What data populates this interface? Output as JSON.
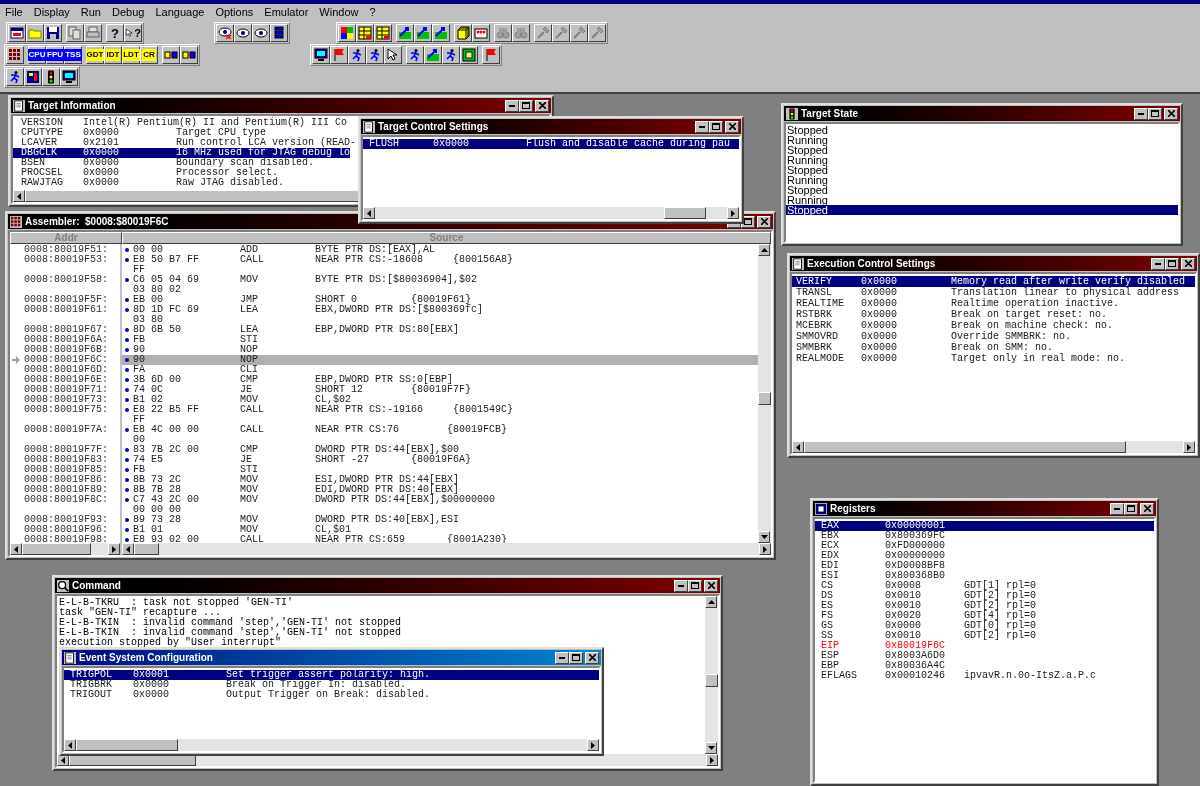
{
  "menu": [
    "File",
    "Display",
    "Run",
    "Debug",
    "Language",
    "Options",
    "Emulator",
    "Window",
    "?"
  ],
  "toolbars": [
    {
      "groups": [
        [
          [
            {
              "kind": "icon",
              "disabled": false
            },
            {
              "kind": "icon",
              "disabled": false
            },
            {
              "kind": "icon",
              "disabled": false
            }
          ],
          [
            {
              "kind": "icon",
              "disabled": true
            },
            {
              "kind": "icon",
              "disabled": true
            }
          ],
          [
            {
              "kind": "glyph",
              "label": "?",
              "disabled": false
            },
            {
              "kind": "pointer_glyph",
              "label": "?",
              "disabled": false
            }
          ]
        ],
        [
          [
            {
              "kind": "icon",
              "disabled": false
            },
            {
              "kind": "icon",
              "disabled": false
            },
            {
              "kind": "icon",
              "disabled": false
            },
            {
              "kind": "icon",
              "disabled": false
            }
          ]
        ],
        [
          [
            {
              "kind": "icon",
              "disabled": false
            },
            {
              "kind": "icon",
              "disabled": false
            },
            {
              "kind": "icon",
              "disabled": false
            }
          ],
          [
            {
              "kind": "icon",
              "disabled": false
            },
            {
              "kind": "icon",
              "disabled": false
            },
            {
              "kind": "icon",
              "disabled": false
            }
          ],
          [
            {
              "kind": "icon",
              "disabled": false
            },
            {
              "kind": "icon",
              "disabled": false
            }
          ],
          [
            {
              "kind": "icon",
              "disabled": true
            },
            {
              "kind": "icon",
              "disabled": true
            }
          ],
          [
            {
              "kind": "icon",
              "disabled": true
            },
            {
              "kind": "icon",
              "disabled": true
            },
            {
              "kind": "icon",
              "disabled": true
            },
            {
              "kind": "icon",
              "disabled": true
            }
          ]
        ]
      ]
    },
    {
      "groups": [
        [
          [
            {
              "kind": "icon",
              "disabled": false
            }
          ],
          [
            {
              "kind": "text",
              "label": "CPU",
              "color": "#0000ff",
              "disabled": false
            },
            {
              "kind": "text",
              "label": "FPU",
              "color": "#0000ff",
              "disabled": false
            },
            {
              "kind": "text",
              "label": "TSS",
              "color": "#0000ff",
              "disabled": false
            }
          ],
          [
            {
              "kind": "text",
              "label": "GDT",
              "color": "#ffff00",
              "disabled": false
            },
            {
              "kind": "text",
              "label": "IDT",
              "color": "#ffff00",
              "disabled": false
            },
            {
              "kind": "text",
              "label": "LDT",
              "color": "#ffff00",
              "disabled": false
            },
            {
              "kind": "text",
              "label": "CR",
              "color": "#ffff00",
              "disabled": false
            }
          ],
          [
            {
              "kind": "icon",
              "disabled": false
            },
            {
              "kind": "icon",
              "disabled": false
            }
          ]
        ],
        [
          [
            {
              "kind": "icon",
              "disabled": false
            },
            {
              "kind": "icon",
              "disabled": false
            },
            {
              "kind": "icon",
              "disabled": false
            },
            {
              "kind": "icon",
              "disabled": false
            },
            {
              "kind": "icon",
              "disabled": false
            }
          ],
          [
            {
              "kind": "icon",
              "disabled": false
            },
            {
              "kind": "icon",
              "disabled": false
            },
            {
              "kind": "icon",
              "disabled": false
            },
            {
              "kind": "icon",
              "disabled": false
            }
          ],
          [
            {
              "kind": "icon",
              "disabled": false
            }
          ]
        ]
      ]
    },
    {
      "groups": [
        [
          [
            {
              "kind": "icon",
              "disabled": false
            },
            {
              "kind": "icon",
              "disabled": false
            },
            {
              "kind": "icon",
              "disabled": false
            },
            {
              "kind": "icon",
              "disabled": false
            }
          ]
        ]
      ]
    }
  ],
  "windows": [
    {
      "title": "Target Information",
      "active": false,
      "kind": "settings",
      "rows": [
        {
          "name": "VERSION",
          "value": "Intel(R) Pentium(R) II and Pentium(R) III Co",
          "selected": false
        },
        {
          "name": "CPUTYPE",
          "value": "0x0000",
          "description": "Target CPU type",
          "selected": false
        },
        {
          "name": "LCAVER",
          "value": "0x2101",
          "description": "Run control LCA version (READ-",
          "selected": false
        },
        {
          "name": "DBGCLK",
          "value": "0x0000",
          "description": "16 MHz used for JTAG debug lo",
          "selected": true
        },
        {
          "name": "BSEN",
          "value": "0x0000",
          "description": "Boundary scan disabled.",
          "selected": false
        },
        {
          "name": "PROCSEL",
          "value": "0x0000",
          "description": "Processor select.",
          "selected": false
        },
        {
          "name": "RAWJTAG",
          "value": "0x0000",
          "description": "Raw JTAG disabled.",
          "selected": false
        }
      ]
    },
    {
      "title": "Assembler:  $0008:$80019F6C",
      "active": false,
      "kind": "assembler",
      "columns": [
        "Addr",
        "Source"
      ],
      "rows": [
        {
          "addr": "0008:80019F51:",
          "bytes": [
            "00 00"
          ],
          "mnemonic": "ADD",
          "operands": "BYTE PTR DS:[EAX],AL",
          "selected": false
        },
        {
          "addr": "0008:80019F53:",
          "bytes": [
            "E8 50 B7 FF",
            "FF"
          ],
          "mnemonic": "CALL",
          "operands": "NEAR PTR CS:-18608     {800156A8}",
          "selected": false
        },
        {
          "addr": "0008:80019F58:",
          "bytes": [
            "C6 05 04 69",
            "03 80 02"
          ],
          "mnemonic": "MOV",
          "operands": "BYTE PTR DS:[$80036904],$02",
          "selected": false
        },
        {
          "addr": "0008:80019F5F:",
          "bytes": [
            "EB 00"
          ],
          "mnemonic": "JMP",
          "operands": "SHORT 0         {80019F61}",
          "selected": false
        },
        {
          "addr": "0008:80019F61:",
          "bytes": [
            "8D 1D FC 69",
            "03 80"
          ],
          "mnemonic": "LEA",
          "operands": "EBX,DWORD PTR DS:[$800369fc]",
          "selected": false
        },
        {
          "addr": "0008:80019F67:",
          "bytes": [
            "8D 6B 50"
          ],
          "mnemonic": "LEA",
          "operands": "EBP,DWORD PTR DS:80[EBX]",
          "selected": false
        },
        {
          "addr": "0008:80019F6A:",
          "bytes": [
            "FB"
          ],
          "mnemonic": "STI",
          "selected": false
        },
        {
          "addr": "0008:80019F6B:",
          "bytes": [
            "90"
          ],
          "mnemonic": "NOP",
          "selected": false
        },
        {
          "addr": "0008:80019F6C:",
          "bytes": [
            "90"
          ],
          "mnemonic": "NOP",
          "selected": true
        },
        {
          "addr": "0008:80019F6D:",
          "bytes": [
            "FA"
          ],
          "mnemonic": "CLI",
          "selected": false
        },
        {
          "addr": "0008:80019F6E:",
          "bytes": [
            "3B 6D 00"
          ],
          "mnemonic": "CMP",
          "operands": "EBP,DWORD PTR SS:0[EBP]",
          "selected": false
        },
        {
          "addr": "0008:80019F71:",
          "bytes": [
            "74 0C"
          ],
          "mnemonic": "JE",
          "operands": "SHORT 12        {80019F7F}",
          "selected": false
        },
        {
          "addr": "0008:80019F73:",
          "bytes": [
            "B1 02"
          ],
          "mnemonic": "MOV",
          "operands": "CL,$02",
          "selected": false
        },
        {
          "addr": "0008:80019F75:",
          "bytes": [
            "E8 22 B5 FF",
            "FF"
          ],
          "mnemonic": "CALL",
          "operands": "NEAR PTR CS:-19166     {8001549C}",
          "selected": false
        },
        {
          "addr": "0008:80019F7A:",
          "bytes": [
            "E8 4C 00 00",
            "00"
          ],
          "mnemonic": "CALL",
          "operands": "NEAR PTR CS:76        {80019FCB}",
          "selected": false
        },
        {
          "addr": "0008:80019F7F:",
          "bytes": [
            "83 7B 2C 00"
          ],
          "mnemonic": "CMP",
          "operands": "DWORD PTR DS:44[EBX],$00",
          "selected": false
        },
        {
          "addr": "0008:80019F83:",
          "bytes": [
            "74 E5"
          ],
          "mnemonic": "JE",
          "operands": "SHORT -27       {80019F6A}",
          "selected": false
        },
        {
          "addr": "0008:80019F85:",
          "bytes": [
            "FB"
          ],
          "mnemonic": "STI",
          "selected": false
        },
        {
          "addr": "0008:80019F86:",
          "bytes": [
            "8B 73 2C"
          ],
          "mnemonic": "MOV",
          "operands": "ESI,DWORD PTR DS:44[EBX]",
          "selected": false
        },
        {
          "addr": "0008:80019F89:",
          "bytes": [
            "8B 7B 28"
          ],
          "mnemonic": "MOV",
          "operands": "EDI,DWORD PTR DS:40[EBX]",
          "selected": false
        },
        {
          "addr": "0008:80019F8C:",
          "bytes": [
            "C7 43 2C 00",
            "00 00 00"
          ],
          "mnemonic": "MOV",
          "operands": "DWORD PTR DS:44[EBX],$00000000",
          "selected": false
        },
        {
          "addr": "0008:80019F93:",
          "bytes": [
            "89 73 28"
          ],
          "mnemonic": "MOV",
          "operands": "DWORD PTR DS:40[EBX],ESI",
          "selected": false
        },
        {
          "addr": "0008:80019F96:",
          "bytes": [
            "B1 01"
          ],
          "mnemonic": "MOV",
          "operands": "CL,$01",
          "selected": false
        },
        {
          "addr": "0008:80019F98:",
          "bytes": [
            "E8 93 02 00"
          ],
          "mnemonic": "CALL",
          "operands": "NEAR PTR CS:659       {8001A230}",
          "selected": false
        }
      ]
    },
    {
      "title": "Target Control Settings",
      "active": false,
      "kind": "settings",
      "rows": [
        {
          "name": "FLUSH",
          "value": "0x0000",
          "description": "Flush and disable cache during pau",
          "selected": true
        }
      ]
    },
    {
      "title": "Target State",
      "active": false,
      "kind": "states",
      "rows": [
        {
          "text": "Stopped",
          "selected": false
        },
        {
          "text": "Running",
          "selected": false
        },
        {
          "text": "Stopped",
          "selected": false
        },
        {
          "text": "Running",
          "selected": false
        },
        {
          "text": "Stopped",
          "selected": false
        },
        {
          "text": "Running",
          "selected": false
        },
        {
          "text": "Stopped",
          "selected": false
        },
        {
          "text": "Running",
          "selected": false
        },
        {
          "text": "Stopped",
          "selected": true
        }
      ]
    },
    {
      "title": "Execution Control Settings",
      "active": false,
      "kind": "settings",
      "rows": [
        {
          "name": "VERIFY",
          "value": "0x0000",
          "description": "Memory read after write verify disabled",
          "selected": true
        },
        {
          "name": "TRANSL",
          "value": "0x0000",
          "description": "Translation linear to physical address",
          "selected": false
        },
        {
          "name": "REALTIME",
          "value": "0x0000",
          "description": "Realtime operation inactive.",
          "selected": false
        },
        {
          "name": "RSTBRK",
          "value": "0x0000",
          "description": "Break on target reset: no.",
          "selected": false
        },
        {
          "name": "MCEBRK",
          "value": "0x0000",
          "description": "Break on machine check: no.",
          "selected": false
        },
        {
          "name": "SMMOVRD",
          "value": "0x0000",
          "description": "Override SMMBRK: no.",
          "selected": false
        },
        {
          "name": "SMMBRK",
          "value": "0x0000",
          "description": "Break on SMM: no.",
          "selected": false
        },
        {
          "name": "REALMODE",
          "value": "0x0000",
          "description": "Target only in real mode: no.",
          "selected": false
        }
      ]
    },
    {
      "title": "Registers",
      "active": false,
      "kind": "registers",
      "rows": [
        {
          "name": "EAX",
          "value": "0x00000001",
          "selected": true,
          "changed": false
        },
        {
          "name": "EBX",
          "value": "0x800369FC",
          "selected": false,
          "changed": false
        },
        {
          "name": "ECX",
          "value": "0xFD000000",
          "selected": false,
          "changed": false
        },
        {
          "name": "EDX",
          "value": "0x00000000",
          "selected": false,
          "changed": false
        },
        {
          "name": "EDI",
          "value": "0xD0008BF8",
          "selected": false,
          "changed": false
        },
        {
          "name": "ESI",
          "value": "0x800368B0",
          "selected": false,
          "changed": false
        },
        {
          "name": "CS",
          "value": "0x0008",
          "info": "GDT[1] rpl=0",
          "selected": false,
          "changed": false
        },
        {
          "name": "DS",
          "value": "0x0010",
          "info": "GDT[2] rpl=0",
          "selected": false,
          "changed": false
        },
        {
          "name": "ES",
          "value": "0x0010",
          "info": "GDT[2] rpl=0",
          "selected": false,
          "changed": false
        },
        {
          "name": "FS",
          "value": "0x0020",
          "info": "GDT[4] rpl=0",
          "selected": false,
          "changed": false
        },
        {
          "name": "GS",
          "value": "0x0000",
          "info": "GDT[0] rpl=0",
          "selected": false,
          "changed": false
        },
        {
          "name": "SS",
          "value": "0x0010",
          "info": "GDT[2] rpl=0",
          "selected": false,
          "changed": false
        },
        {
          "name": "EIP",
          "value": "0x80019F6C",
          "selected": false,
          "changed": true
        },
        {
          "name": "ESP",
          "value": "0x8003A6D0",
          "selected": false,
          "changed": false
        },
        {
          "name": "EBP",
          "value": "0x80036A4C",
          "selected": false,
          "changed": false
        },
        {
          "name": "EFLAGS",
          "value": "0x00010246",
          "info": "ipvavR.n.0o-ItsZ.a.P.c",
          "selected": false,
          "changed": false
        }
      ]
    },
    {
      "title": "Command",
      "active": false,
      "kind": "log",
      "lines": [
        "E-L-B-TKRU  : task not stopped 'GEN-TI'",
        "task \"GEN-TI\" recapture ...",
        "E-L-B-TKIN  : invalid command 'step','GEN-TI' not stopped",
        "E-L-B-TKIN  : invalid command 'step','GEN-TI' not stopped",
        "execution stopped by \"User interrupt\""
      ]
    },
    {
      "title": "Event System Configuration",
      "active": true,
      "kind": "settings",
      "rows": [
        {
          "name": "TRIGPOL",
          "value": "0x0001",
          "description": "Set trigger assert polarity: high.",
          "selected": true
        },
        {
          "name": "TRIGBRK",
          "value": "0x0000",
          "description": "Break on Trigger In: disabled.",
          "selected": false
        },
        {
          "name": "TRIGOUT",
          "value": "0x0000",
          "description": "Output Trigger on Break: disabled.",
          "selected": false
        }
      ]
    }
  ]
}
